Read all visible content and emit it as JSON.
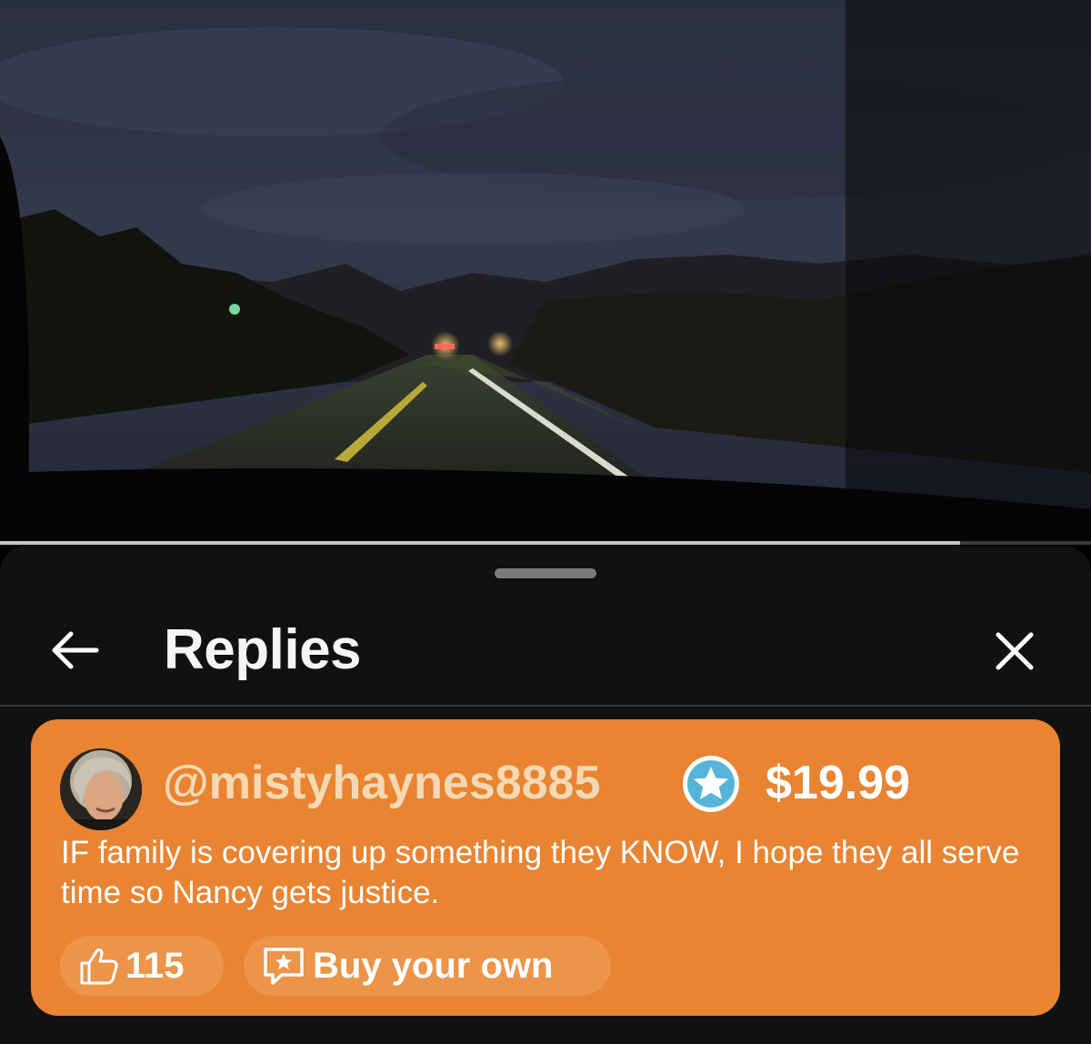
{
  "video": {
    "progress": 0.88
  },
  "header": {
    "title": "Replies"
  },
  "reply": {
    "username": "@mistyhaynes8885",
    "price": "$19.99",
    "message": "IF family is covering up something they KNOW, I hope they all serve time so Nancy gets justice.",
    "likes": "115",
    "buy_label": "Buy your own"
  },
  "colors": {
    "card": "#e88432",
    "chip": "#ec9448",
    "username": "#f6d9b4",
    "verified_badge": "#56b4d6",
    "sheet": "#111112"
  },
  "icons": {
    "back": "arrow-left-icon",
    "close": "close-icon",
    "verified": "verified-star-badge-icon",
    "like": "thumbs-up-icon",
    "buy": "chat-star-icon"
  }
}
